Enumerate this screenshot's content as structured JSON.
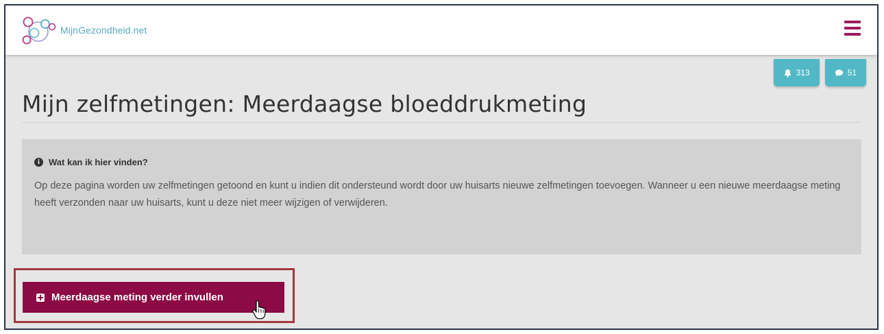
{
  "header": {
    "logo_text": "MijnGezondheid.net",
    "menu_icon": "hamburger-menu-icon"
  },
  "badges": {
    "notifications_count": "313",
    "notifications_icon": "bell-icon",
    "messages_count": "51",
    "messages_icon": "chat-bubble-icon"
  },
  "main": {
    "title": "Mijn zelfmetingen: Meerdaagse bloeddrukmeting"
  },
  "info": {
    "icon": "info-icon",
    "heading": "Wat kan ik hier vinden?",
    "body": "Op deze pagina worden uw zelfmetingen getoond en kunt u indien dit ondersteund wordt door uw huisarts nieuwe zelfmetingen toevoegen. Wanneer u een nieuwe meerdaagse meting heeft verzonden naar uw huisarts, kunt u deze niet meer wijzigen of verwijderen."
  },
  "actions": {
    "continue_label": "Meerdaagse meting verder invullen",
    "continue_icon": "plus-square-icon"
  },
  "colors": {
    "brand_primary": "#8c0a45",
    "menu": "#9c1c5b",
    "badge": "#52b8c5",
    "logo_text": "#5aa9c2",
    "highlight_border": "#a1383f",
    "page_background": "#e6e6e6",
    "info_background": "#d2d2d2"
  }
}
